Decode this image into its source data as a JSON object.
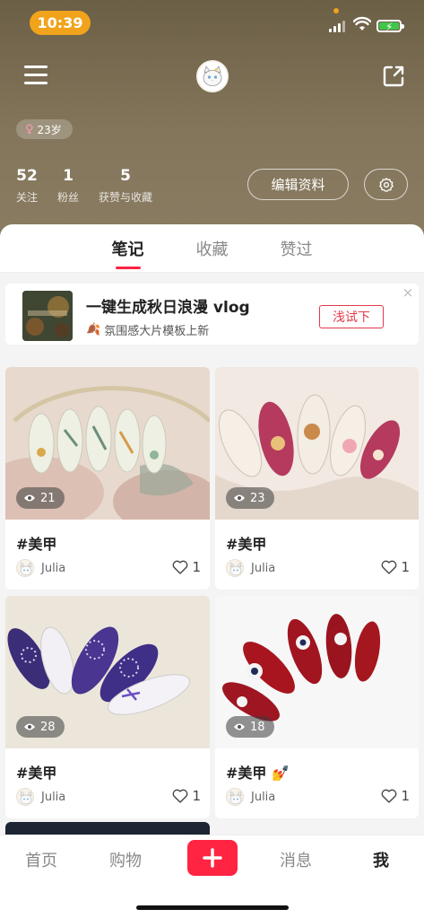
{
  "status_bar": {
    "time": "10:39"
  },
  "profile": {
    "age_badge": "23岁",
    "stats": [
      {
        "num": "52",
        "label": "关注"
      },
      {
        "num": "1",
        "label": "粉丝"
      },
      {
        "num": "5",
        "label": "获赞与收藏"
      }
    ],
    "edit_label": "编辑资料"
  },
  "tabs": [
    {
      "label": "笔记",
      "active": true
    },
    {
      "label": "收藏",
      "active": false
    },
    {
      "label": "赞过",
      "active": false
    }
  ],
  "banner": {
    "title": "一键生成秋日浪漫 vlog",
    "subtitle": "氛围感大片模板上新",
    "cta": "浅试下"
  },
  "notes": [
    {
      "title": "#美甲",
      "views": "21",
      "author": "Julia",
      "likes": "1"
    },
    {
      "title": "#美甲",
      "views": "23",
      "author": "Julia",
      "likes": "1"
    },
    {
      "title": "#美甲",
      "views": "28",
      "author": "Julia",
      "likes": "1"
    },
    {
      "title": "#美甲 💅",
      "views": "18",
      "author": "Julia",
      "likes": "1"
    }
  ],
  "bottom_nav": {
    "home": "首页",
    "shop": "购物",
    "messages": "消息",
    "me": "我"
  },
  "colors": {
    "accent": "#ff2442",
    "header_bg": "#7d6f55",
    "time_pill": "#f0a31b"
  }
}
